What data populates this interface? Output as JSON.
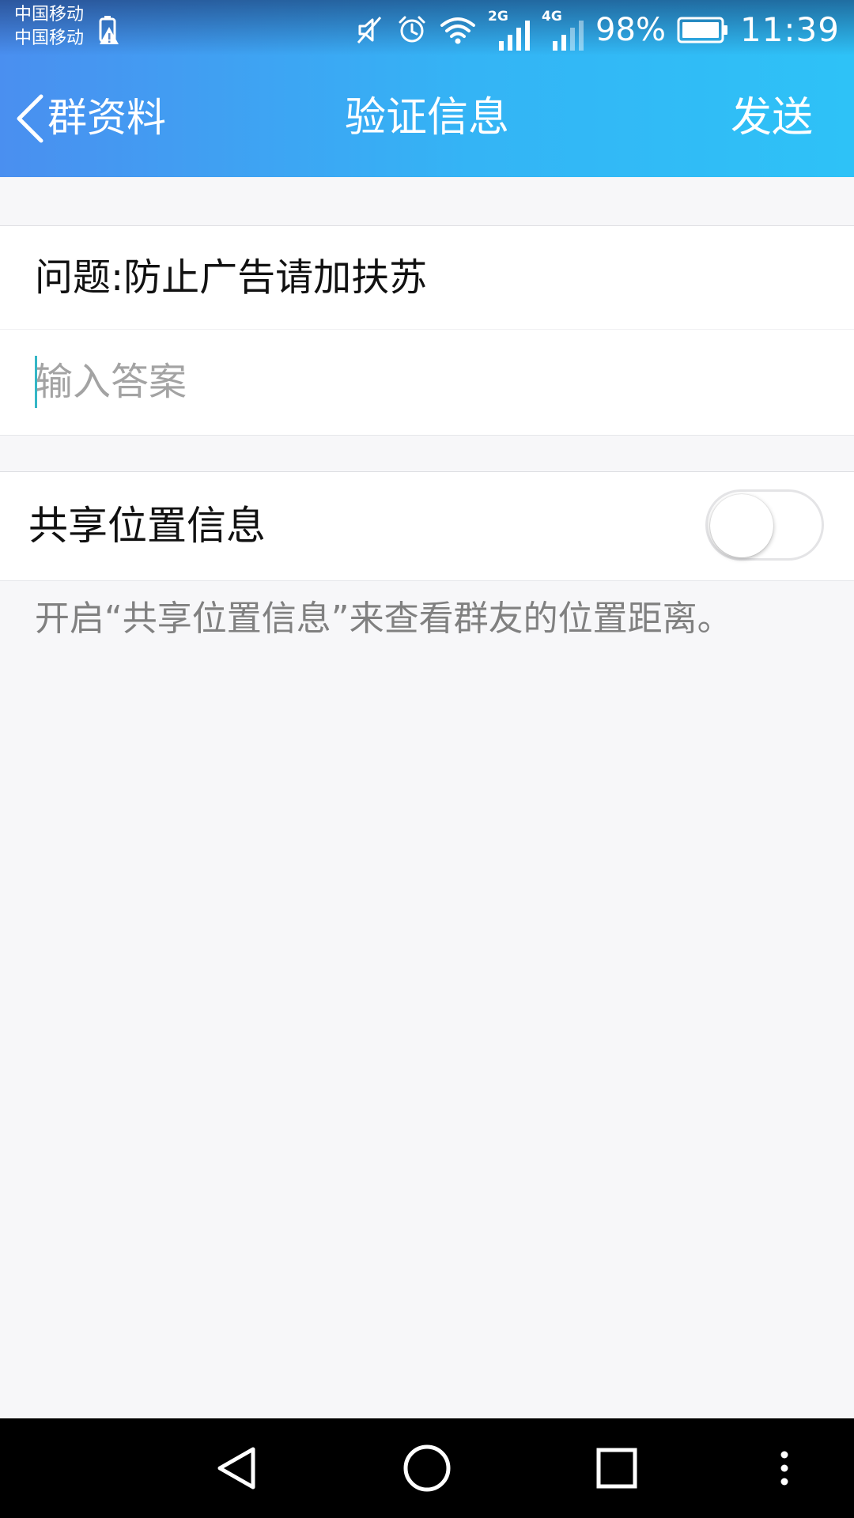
{
  "status_bar": {
    "carriers": [
      "中国移动",
      "中国移动"
    ],
    "network_types": [
      "2G",
      "4G"
    ],
    "battery_percent": "98%",
    "time": "11:39",
    "icons": [
      "battery-alert-icon",
      "mute-icon",
      "alarm-icon",
      "wifi-icon",
      "signal-icon",
      "battery-icon"
    ]
  },
  "title_bar": {
    "back_label": "群资料",
    "title": "验证信息",
    "send_label": "发送"
  },
  "form": {
    "question": "问题:防止广告请加扶苏",
    "answer_placeholder": "输入答案",
    "answer_value": ""
  },
  "location_share": {
    "label": "共享位置信息",
    "enabled": false,
    "hint": "开启“共享位置信息”来查看群友的位置距离。"
  },
  "nav_bar": {
    "icons": [
      "back-triangle-icon",
      "home-circle-icon",
      "recents-square-icon",
      "more-dots-icon"
    ]
  },
  "colors": {
    "header_gradient_start": "#4a8ff0",
    "header_gradient_end": "#2ec2f7",
    "background": "#f7f7f9",
    "caret": "#35b6c6",
    "hint_text": "#808080"
  }
}
